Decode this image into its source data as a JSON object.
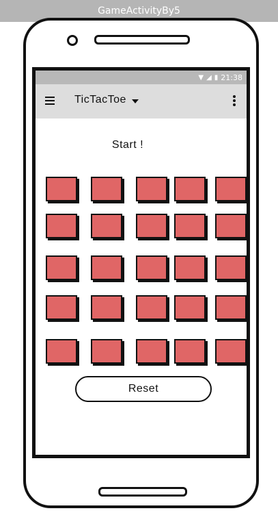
{
  "window": {
    "title": "GameActivityBy5"
  },
  "statusbar": {
    "time": "21:38"
  },
  "toolbar": {
    "title": "TicTacToe"
  },
  "game": {
    "status": "Start !",
    "rows": 5,
    "cols": 5,
    "cell_color": "#e06666",
    "reset_label": "Reset"
  }
}
